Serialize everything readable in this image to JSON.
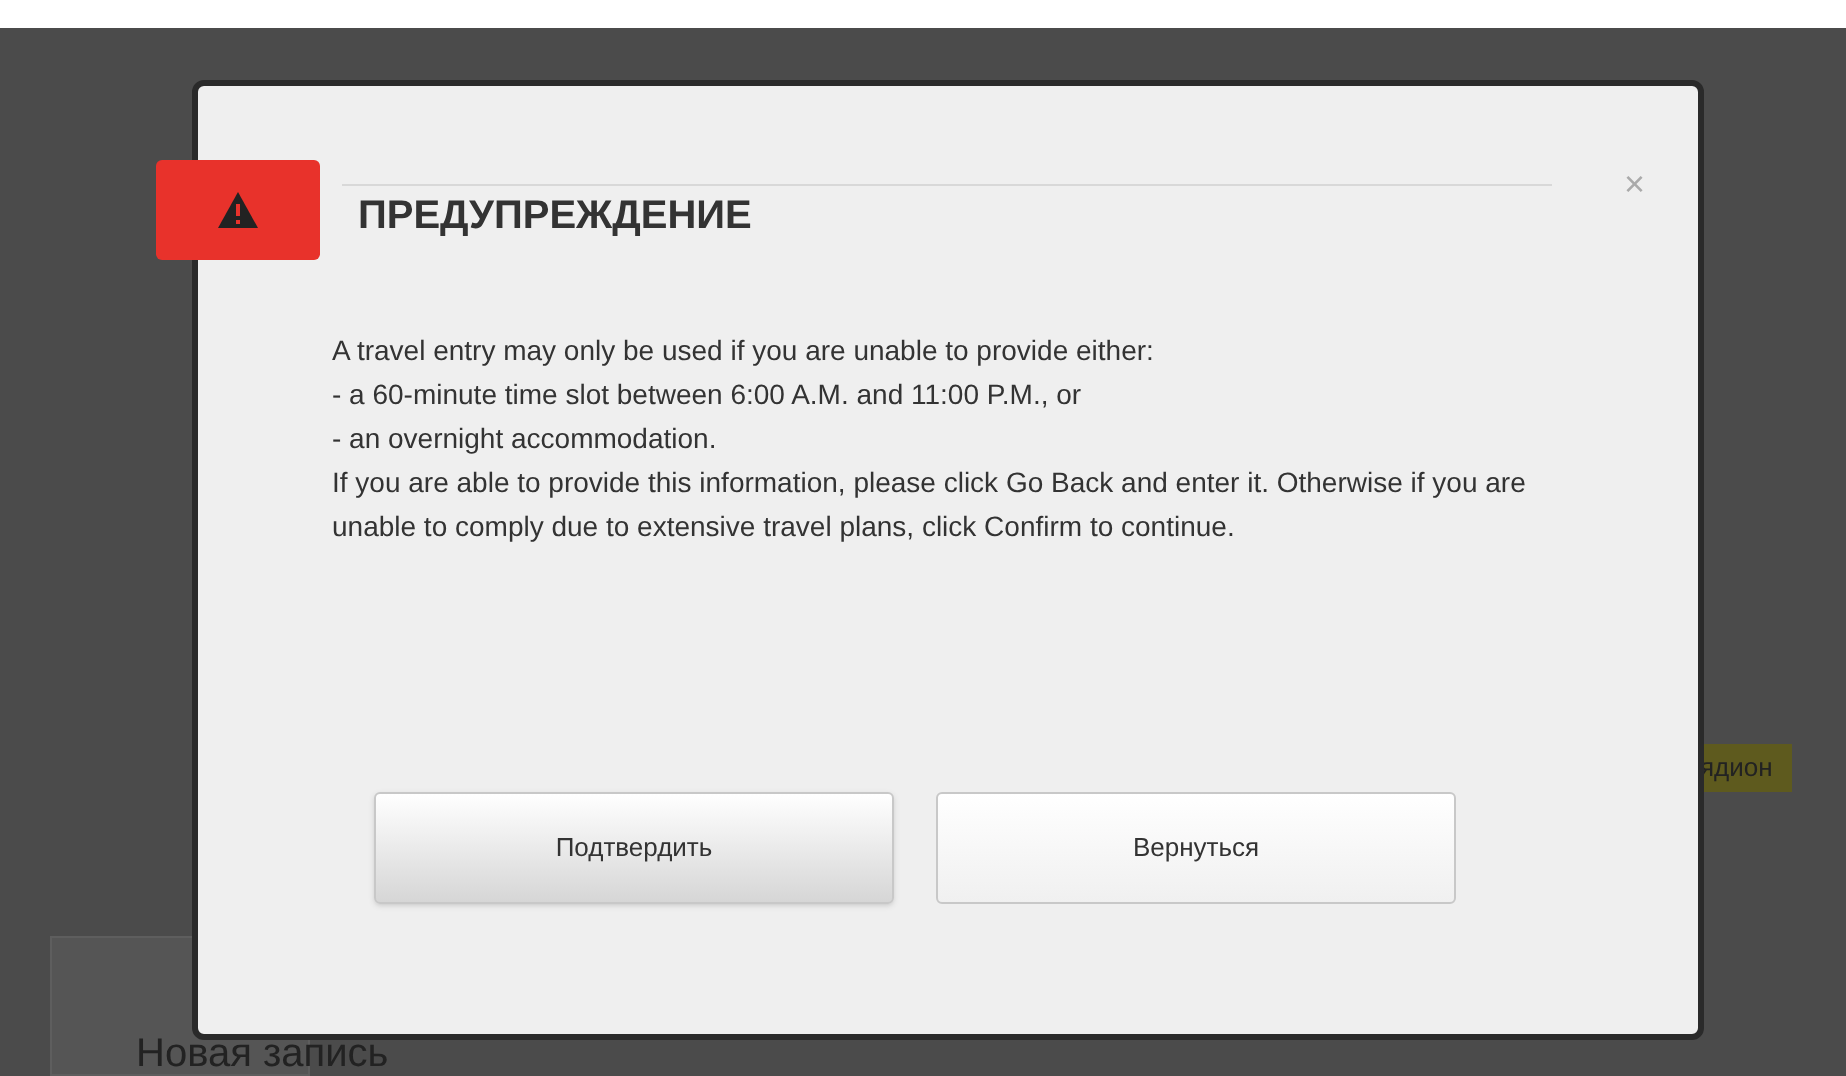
{
  "background": {
    "tag": "ядион",
    "section_title": "Новая запись"
  },
  "dialog": {
    "title": "ПРЕДУПРЕЖДЕНИЕ",
    "close": "×",
    "message": [
      "A travel entry may only be used if you are unable to provide either:",
      "- a 60-minute time slot between 6:00 A.M. and 11:00 P.M., or",
      "- an overnight accommodation.",
      "If you are able to provide this information, please click Go Back and enter it. Otherwise if you are unable to comply due to extensive travel plans, click Confirm to continue."
    ],
    "buttons": [
      {
        "label": "Подтвердить",
        "kind": "primary"
      },
      {
        "label": "Вернуться",
        "kind": "secondary"
      }
    ]
  }
}
